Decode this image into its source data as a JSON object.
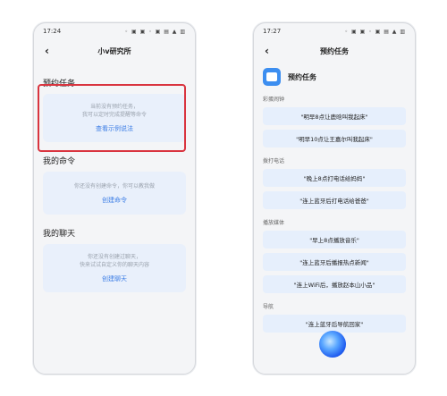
{
  "left_phone": {
    "status": {
      "time": "17:24",
      "icons": "◦ ▣ ▣ ◦ ▣ ▤ ▲ ▥"
    },
    "nav": {
      "title": "小v研究所"
    },
    "sections": [
      {
        "title": "预约任务",
        "text": "当前没有预约任务，\n我可以定时完成提醒等命令",
        "link": "查看示例说法"
      },
      {
        "title": "我的命令",
        "text": "你还没有创建命令，你可以教我做",
        "link": "创建命令"
      },
      {
        "title": "我的聊天",
        "text": "你还没有创建过聊天，\n快来试试自定义你的聊天内容",
        "link": "创建聊天"
      }
    ]
  },
  "right_phone": {
    "status": {
      "time": "17:27",
      "icons": "◦ ▣ ▣ ◦ ▣ ▤ ▲ ▥"
    },
    "nav": {
      "title": "预约任务"
    },
    "header_title": "预约任务",
    "categories": [
      {
        "label": "彩蛋闹钟",
        "items": [
          "\"明早8点让鹿晗叫我起床\"",
          "\"明早10点让王嘉尔叫我起床\""
        ]
      },
      {
        "label": "拨打电话",
        "items": [
          "\"晚上8点打电话给妈妈\"",
          "\"连上蓝牙后打电话给爸爸\""
        ]
      },
      {
        "label": "播放媒体",
        "items": [
          "\"早上8点播放音乐\"",
          "\"连上蓝牙后播报热点新闻\"",
          "\"连上WiFi后，播放赵本山小品\""
        ]
      },
      {
        "label": "导航",
        "items": [
          "\"连上蓝牙后导航回家\""
        ]
      }
    ]
  },
  "colors": {
    "accent": "#3d7ee6",
    "highlight": "#d9343f",
    "card_bg": "#e9f0fb"
  }
}
